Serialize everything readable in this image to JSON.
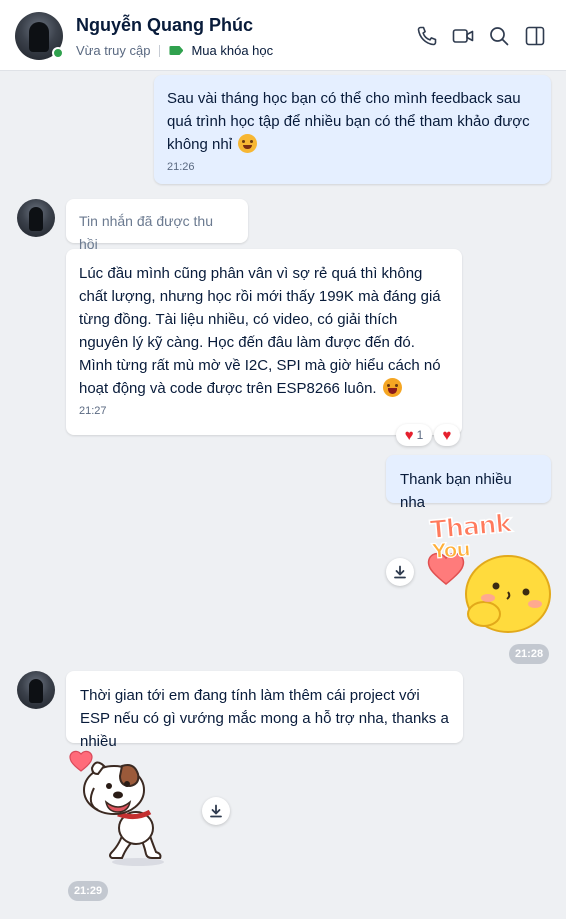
{
  "header": {
    "contact_name": "Nguyễn Quang Phúc",
    "status": "Vừa truy cập",
    "tag_label": "Mua khóa học",
    "icons": [
      "phone-icon",
      "video-call-icon",
      "search-icon",
      "sidebar-toggle-icon"
    ]
  },
  "messages": [
    {
      "direction": "out",
      "text": "Sau vài tháng học bạn có thể cho mình feedback sau quá trình học tập để nhiều bạn có thể tham khảo được không nhỉ",
      "emoji": "smiling-face-icon",
      "time": "21:26"
    },
    {
      "direction": "in",
      "text": "Tin nhắn đã được thu hồi",
      "recalled": true
    },
    {
      "direction": "in",
      "text": "Lúc đầu mình cũng phân vân vì sợ rẻ quá thì không chất lượng, nhưng học rồi mới thấy 199K mà đáng giá từng đồng. Tài liệu nhiều, có video, có giải thích nguyên lý kỹ càng. Học đến đâu làm được đến đó. Mình từng rất mù mờ về I2C, SPI mà giờ hiểu cách nó hoạt động và code được trên ESP8266 luôn.",
      "emoji": "laughing-face-icon",
      "time": "21:27",
      "reaction_count": "1"
    },
    {
      "direction": "out",
      "text": "Thank bạn nhiều nha"
    },
    {
      "direction": "out",
      "sticker": "thank-you-sticker",
      "sticker_text": [
        "Thank",
        "You"
      ],
      "time": "21:28"
    },
    {
      "direction": "in",
      "text": "Thời gian tới em đang tính làm thêm cái project với ESP nếu có gì vướng mắc mong a hỗ trợ nha, thanks a nhiều"
    },
    {
      "direction": "in",
      "sticker": "puppy-heart-sticker",
      "time": "21:29"
    }
  ],
  "colors": {
    "background": "#eef0f3",
    "outgoing_bubble": "#e5efff",
    "incoming_bubble": "#ffffff",
    "online": "#30a14e",
    "heart": "#e5202e",
    "text": "#081b3a"
  }
}
